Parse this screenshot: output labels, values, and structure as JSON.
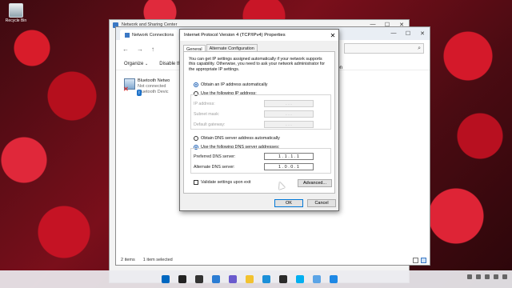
{
  "desktop": {
    "recycle_label": "Recycle Bin"
  },
  "back_window": {
    "title": "Network and Sharing Center"
  },
  "explorer": {
    "tab_title": "Network Connections",
    "nav": {
      "back": "←",
      "forward": "→",
      "up": "↑"
    },
    "address_search_icon": "⌕",
    "organize": "Organize",
    "organize_chevron": "⌄",
    "disable": "Disable th",
    "right_cmd": "ion",
    "adapter": {
      "name": "Bluetooth Netwo",
      "status": "Not connected",
      "device": "Bluetooth Devic"
    },
    "status_items": "2 items",
    "status_selected": "1 item selected"
  },
  "dialog": {
    "title": "Internet Protocol Version 4 (TCP/IPv4) Properties",
    "close": "✕",
    "tabs": [
      "General",
      "Alternate Configuration"
    ],
    "intro": "You can get IP settings assigned automatically if your network supports this capability. Otherwise, you need to ask your network administrator for the appropriate IP settings.",
    "ip_auto": "Obtain an IP address automatically",
    "ip_manual": "Use the following IP address:",
    "ip_address_label": "IP address:",
    "subnet_label": "Subnet mask:",
    "gateway_label": "Default gateway:",
    "empty_ip": ".  .  .",
    "dns_auto": "Obtain DNS server address automatically",
    "dns_manual": "Use the following DNS server addresses:",
    "preferred_label": "Preferred DNS server:",
    "preferred_value": "1 . 1 . 1 . 1",
    "alternate_label": "Alternate DNS server:",
    "alternate_value": "1 . 0 . 0 . 1",
    "validate": "Validate settings upon exit",
    "advanced": "Advanced...",
    "ok": "OK",
    "cancel": "Cancel"
  },
  "window_controls": {
    "minimize": "—",
    "maximize": "☐",
    "close": "✕"
  },
  "taskbar": {
    "icons": [
      "start-icon",
      "search-icon",
      "task-view-icon",
      "widgets-icon",
      "chat-icon",
      "file-explorer-icon",
      "edge-icon",
      "store-icon",
      "skype-icon",
      "notepad-icon",
      "settings-icon"
    ],
    "colors": [
      "#0067c0",
      "#222222",
      "#333333",
      "#2b7cd3",
      "#6a5acd",
      "#f2c230",
      "#1b8fd8",
      "#2a2a2a",
      "#00aff0",
      "#5ba4e6",
      "#1e88e5"
    ]
  }
}
